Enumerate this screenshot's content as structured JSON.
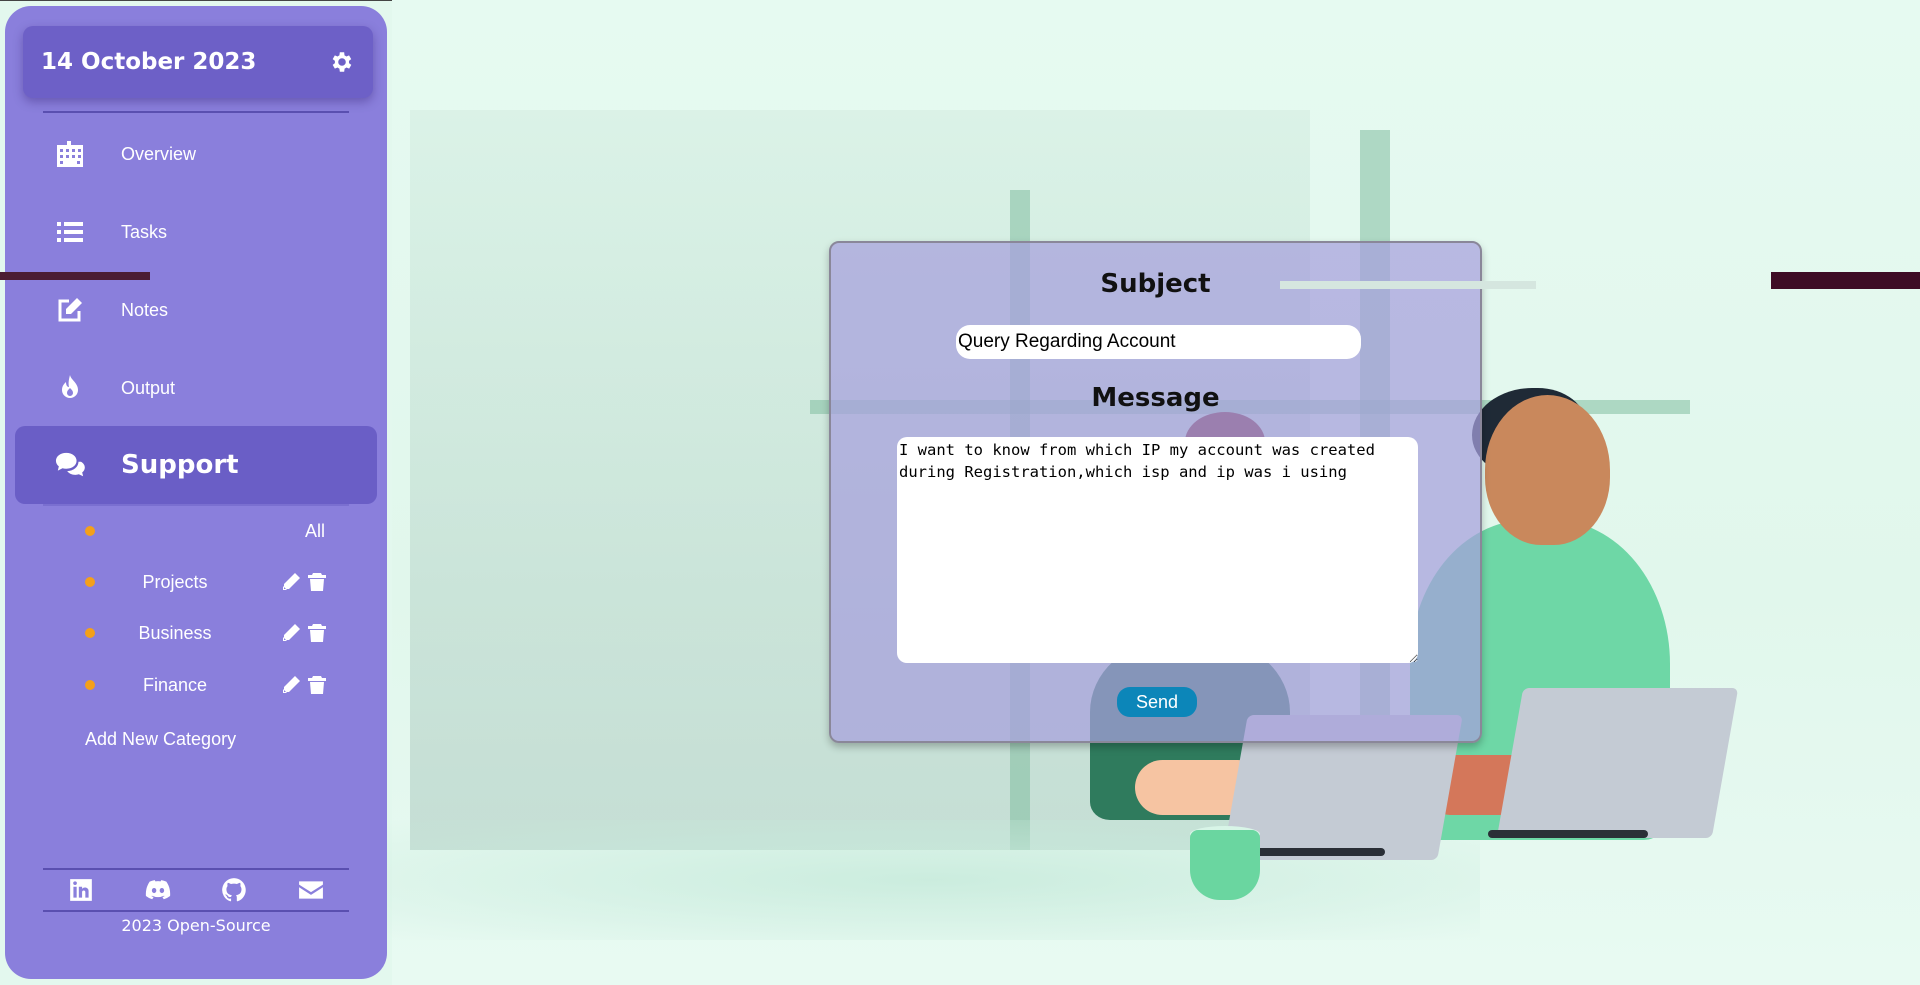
{
  "sidebar": {
    "date": "14 October 2023",
    "nav": [
      {
        "label": "Overview",
        "icon": "building-icon"
      },
      {
        "label": "Tasks",
        "icon": "list-icon"
      },
      {
        "label": "Notes",
        "icon": "edit-icon"
      },
      {
        "label": "Output",
        "icon": "fire-icon"
      },
      {
        "label": "Support",
        "icon": "chat-icon",
        "active": true
      }
    ],
    "categories": [
      {
        "label": "All"
      },
      {
        "label": "Projects"
      },
      {
        "label": "Business"
      },
      {
        "label": "Finance"
      }
    ],
    "add_category": "Add New Category",
    "social": [
      "linkedin-icon",
      "discord-icon",
      "github-icon",
      "mail-icon"
    ],
    "footer": "2023 Open-Source"
  },
  "support": {
    "subject_heading": "Subject",
    "subject_value": "Query Regarding Account",
    "message_heading": "Message",
    "message_value": "I want to know from which IP my account was created during Registration,which isp and ip was i using",
    "send_label": "Send"
  },
  "colors": {
    "sidebar": "#8a7fdc",
    "sidebar_dark": "#6d60c7",
    "bullet": "#f4a01a",
    "send": "#0c86b9",
    "background": "#e3f8ee"
  }
}
